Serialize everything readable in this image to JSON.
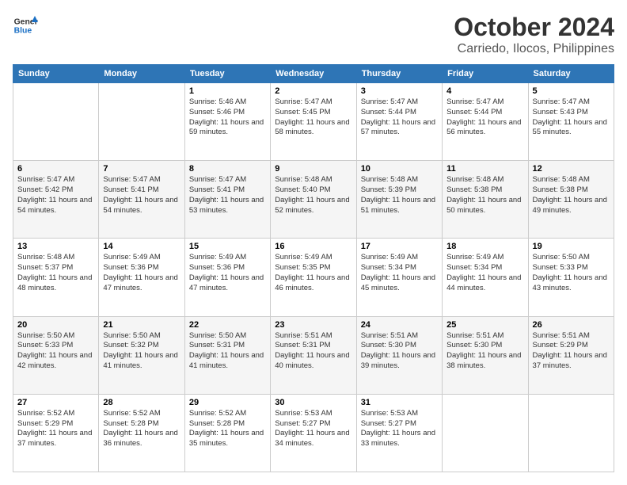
{
  "logo": {
    "line1": "General",
    "line2": "Blue"
  },
  "title": "October 2024",
  "subtitle": "Carriedo, Ilocos, Philippines",
  "days": [
    "Sunday",
    "Monday",
    "Tuesday",
    "Wednesday",
    "Thursday",
    "Friday",
    "Saturday"
  ],
  "weeks": [
    [
      {
        "num": "",
        "info": ""
      },
      {
        "num": "",
        "info": ""
      },
      {
        "num": "1",
        "info": "Sunrise: 5:46 AM\nSunset: 5:46 PM\nDaylight: 11 hours and 59 minutes."
      },
      {
        "num": "2",
        "info": "Sunrise: 5:47 AM\nSunset: 5:45 PM\nDaylight: 11 hours and 58 minutes."
      },
      {
        "num": "3",
        "info": "Sunrise: 5:47 AM\nSunset: 5:44 PM\nDaylight: 11 hours and 57 minutes."
      },
      {
        "num": "4",
        "info": "Sunrise: 5:47 AM\nSunset: 5:44 PM\nDaylight: 11 hours and 56 minutes."
      },
      {
        "num": "5",
        "info": "Sunrise: 5:47 AM\nSunset: 5:43 PM\nDaylight: 11 hours and 55 minutes."
      }
    ],
    [
      {
        "num": "6",
        "info": "Sunrise: 5:47 AM\nSunset: 5:42 PM\nDaylight: 11 hours and 54 minutes."
      },
      {
        "num": "7",
        "info": "Sunrise: 5:47 AM\nSunset: 5:41 PM\nDaylight: 11 hours and 54 minutes."
      },
      {
        "num": "8",
        "info": "Sunrise: 5:47 AM\nSunset: 5:41 PM\nDaylight: 11 hours and 53 minutes."
      },
      {
        "num": "9",
        "info": "Sunrise: 5:48 AM\nSunset: 5:40 PM\nDaylight: 11 hours and 52 minutes."
      },
      {
        "num": "10",
        "info": "Sunrise: 5:48 AM\nSunset: 5:39 PM\nDaylight: 11 hours and 51 minutes."
      },
      {
        "num": "11",
        "info": "Sunrise: 5:48 AM\nSunset: 5:38 PM\nDaylight: 11 hours and 50 minutes."
      },
      {
        "num": "12",
        "info": "Sunrise: 5:48 AM\nSunset: 5:38 PM\nDaylight: 11 hours and 49 minutes."
      }
    ],
    [
      {
        "num": "13",
        "info": "Sunrise: 5:48 AM\nSunset: 5:37 PM\nDaylight: 11 hours and 48 minutes."
      },
      {
        "num": "14",
        "info": "Sunrise: 5:49 AM\nSunset: 5:36 PM\nDaylight: 11 hours and 47 minutes."
      },
      {
        "num": "15",
        "info": "Sunrise: 5:49 AM\nSunset: 5:36 PM\nDaylight: 11 hours and 47 minutes."
      },
      {
        "num": "16",
        "info": "Sunrise: 5:49 AM\nSunset: 5:35 PM\nDaylight: 11 hours and 46 minutes."
      },
      {
        "num": "17",
        "info": "Sunrise: 5:49 AM\nSunset: 5:34 PM\nDaylight: 11 hours and 45 minutes."
      },
      {
        "num": "18",
        "info": "Sunrise: 5:49 AM\nSunset: 5:34 PM\nDaylight: 11 hours and 44 minutes."
      },
      {
        "num": "19",
        "info": "Sunrise: 5:50 AM\nSunset: 5:33 PM\nDaylight: 11 hours and 43 minutes."
      }
    ],
    [
      {
        "num": "20",
        "info": "Sunrise: 5:50 AM\nSunset: 5:33 PM\nDaylight: 11 hours and 42 minutes."
      },
      {
        "num": "21",
        "info": "Sunrise: 5:50 AM\nSunset: 5:32 PM\nDaylight: 11 hours and 41 minutes."
      },
      {
        "num": "22",
        "info": "Sunrise: 5:50 AM\nSunset: 5:31 PM\nDaylight: 11 hours and 41 minutes."
      },
      {
        "num": "23",
        "info": "Sunrise: 5:51 AM\nSunset: 5:31 PM\nDaylight: 11 hours and 40 minutes."
      },
      {
        "num": "24",
        "info": "Sunrise: 5:51 AM\nSunset: 5:30 PM\nDaylight: 11 hours and 39 minutes."
      },
      {
        "num": "25",
        "info": "Sunrise: 5:51 AM\nSunset: 5:30 PM\nDaylight: 11 hours and 38 minutes."
      },
      {
        "num": "26",
        "info": "Sunrise: 5:51 AM\nSunset: 5:29 PM\nDaylight: 11 hours and 37 minutes."
      }
    ],
    [
      {
        "num": "27",
        "info": "Sunrise: 5:52 AM\nSunset: 5:29 PM\nDaylight: 11 hours and 37 minutes."
      },
      {
        "num": "28",
        "info": "Sunrise: 5:52 AM\nSunset: 5:28 PM\nDaylight: 11 hours and 36 minutes."
      },
      {
        "num": "29",
        "info": "Sunrise: 5:52 AM\nSunset: 5:28 PM\nDaylight: 11 hours and 35 minutes."
      },
      {
        "num": "30",
        "info": "Sunrise: 5:53 AM\nSunset: 5:27 PM\nDaylight: 11 hours and 34 minutes."
      },
      {
        "num": "31",
        "info": "Sunrise: 5:53 AM\nSunset: 5:27 PM\nDaylight: 11 hours and 33 minutes."
      },
      {
        "num": "",
        "info": ""
      },
      {
        "num": "",
        "info": ""
      }
    ]
  ]
}
